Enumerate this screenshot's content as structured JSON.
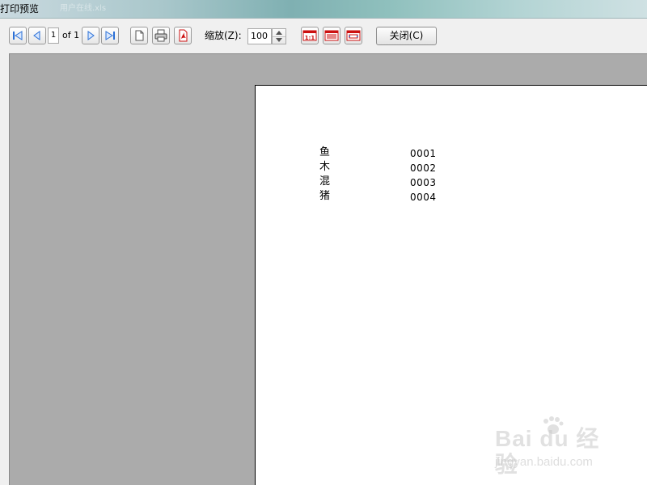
{
  "window": {
    "title": "打印预览",
    "title_ghost": "用户在线.xls"
  },
  "toolbar": {
    "current_page": "1",
    "of_text": "of 1",
    "zoom_label": "缩放(Z):",
    "zoom_value": "100",
    "close_label": "关闭(C)"
  },
  "icons": {
    "first": "first-page-icon",
    "prev": "previous-page-icon",
    "next": "next-page-icon",
    "last": "last-page-icon",
    "page_setup": "page-setup-icon",
    "print": "printer-icon",
    "pdf": "pdf-export-icon",
    "actual_size": "actual-size-icon",
    "fit_page": "fit-page-icon",
    "fit_width": "fit-width-icon"
  },
  "document": {
    "rows": [
      {
        "name": "鱼",
        "code": "0001"
      },
      {
        "name": "木",
        "code": "0002"
      },
      {
        "name": "混",
        "code": "0003"
      },
      {
        "name": "猪",
        "code": "0004"
      }
    ]
  },
  "watermark": {
    "main": "Bai du 经验",
    "sub": "jingyan.baidu.com"
  },
  "colors": {
    "nav_blue": "#2a6fd6",
    "pdf_red": "#cc1111",
    "preview_bg": "#ababab"
  }
}
